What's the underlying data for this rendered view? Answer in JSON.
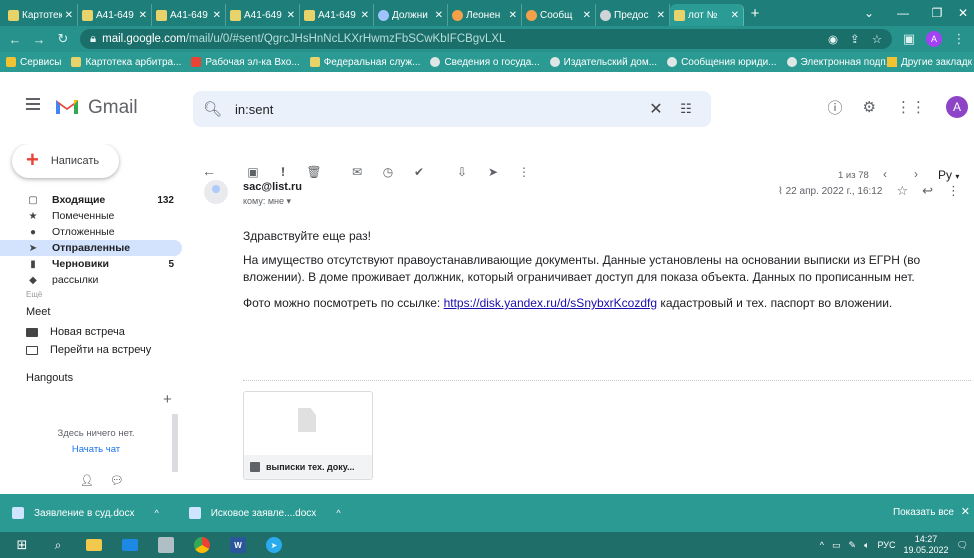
{
  "browser": {
    "tabs": [
      {
        "label": "Картотека",
        "fav": "yellow"
      },
      {
        "label": "А41-649",
        "fav": "yellow"
      },
      {
        "label": "А41-649",
        "fav": "yellow"
      },
      {
        "label": "А41-649",
        "fav": "yellow"
      },
      {
        "label": "А41-649",
        "fav": "yellow"
      },
      {
        "label": "Должни",
        "fav": "blue"
      },
      {
        "label": "Леонен",
        "fav": "orange"
      },
      {
        "label": "Сообщ",
        "fav": "orange"
      },
      {
        "label": "Предос",
        "fav": "grey"
      },
      {
        "label": "лот №",
        "fav": "yellow"
      }
    ],
    "new_tab": "+",
    "url_host": "mail.google.com",
    "url_path": "/mail/u/0/#sent/QgrcJHsHnNcLKXrHwmzFbSCwKbIFCBgvLXL",
    "profile_initial": "A",
    "window_controls": {
      "minimize": "—",
      "maximize": "❐",
      "close": "✕"
    }
  },
  "bookmarks": [
    {
      "label": "Сервисы",
      "icon": "grid-icon"
    },
    {
      "label": "Картотека арбитра...",
      "icon": "bookmark-icon"
    },
    {
      "label": "Рабочая эл-ка Вхо...",
      "icon": "mail-icon"
    },
    {
      "label": "Федеральная служ...",
      "icon": "bookmark-icon"
    },
    {
      "label": "Сведения о госуда...",
      "icon": "globe-icon"
    },
    {
      "label": "Издательский дом...",
      "icon": "globe-icon"
    },
    {
      "label": "Сообщения юриди...",
      "icon": "globe-icon"
    },
    {
      "label": "Электронная подп...",
      "icon": "globe-icon"
    }
  ],
  "bookmarks_other": "Другие закладк",
  "gmail": {
    "brand": "Gmail",
    "search_value": "in:sent",
    "avatar_initial": "A"
  },
  "sidebar": {
    "compose_label": "Написать",
    "items": [
      {
        "label": "Входящие",
        "count": "132",
        "icon": "inbox-icon",
        "bold": true
      },
      {
        "label": "Помеченные",
        "count": "",
        "icon": "star-icon",
        "bold": false
      },
      {
        "label": "Отложенные",
        "count": "",
        "icon": "clock-icon",
        "bold": false
      },
      {
        "label": "Отправленные",
        "count": "",
        "icon": "send-icon",
        "bold": true
      },
      {
        "label": "Черновики",
        "count": "5",
        "icon": "draft-icon",
        "bold": true
      },
      {
        "label": "рассылки",
        "count": "",
        "icon": "label-icon",
        "bold": false
      }
    ],
    "more_label": "Ещё",
    "meet_title": "Meet",
    "meet_new": "Новая встреча",
    "meet_join": "Перейти на встречу",
    "hangouts_title": "Hangouts",
    "hangouts_empty": "Здесь ничего нет.",
    "hangouts_start": "Начать чат"
  },
  "message": {
    "pager": "1 из 78",
    "lang": "Ру",
    "sender": "sac@list.ru",
    "recipient": "кому: мне",
    "date": "22 апр. 2022 г., 16:12",
    "greeting": "Здравствуйте еще раз!",
    "para1": "На имущество отсутствуют правоустанавливающие документы. Данные установлены на основании выписки из ЕГРН (во вложении). В доме проживает должник, который ограничивает доступ для показа объекта. Данных по прописанным нет.",
    "para2_before": "Фото можно посмотреть по ссылке: ",
    "para2_link": "https://disk.yandex.ru/d/sSnybxrKcozdfg",
    "para2_after": "  кадастровый и тех. паспорт во вложении.",
    "attachment_name": "выписки тех. доку..."
  },
  "downloads": {
    "items": [
      "Заявление в суд.docx",
      "Исковое заявле....docx"
    ],
    "show_all": "Показать все"
  },
  "taskbar": {
    "lang": "РУС",
    "time": "14:27",
    "date": "19.05.2022"
  }
}
